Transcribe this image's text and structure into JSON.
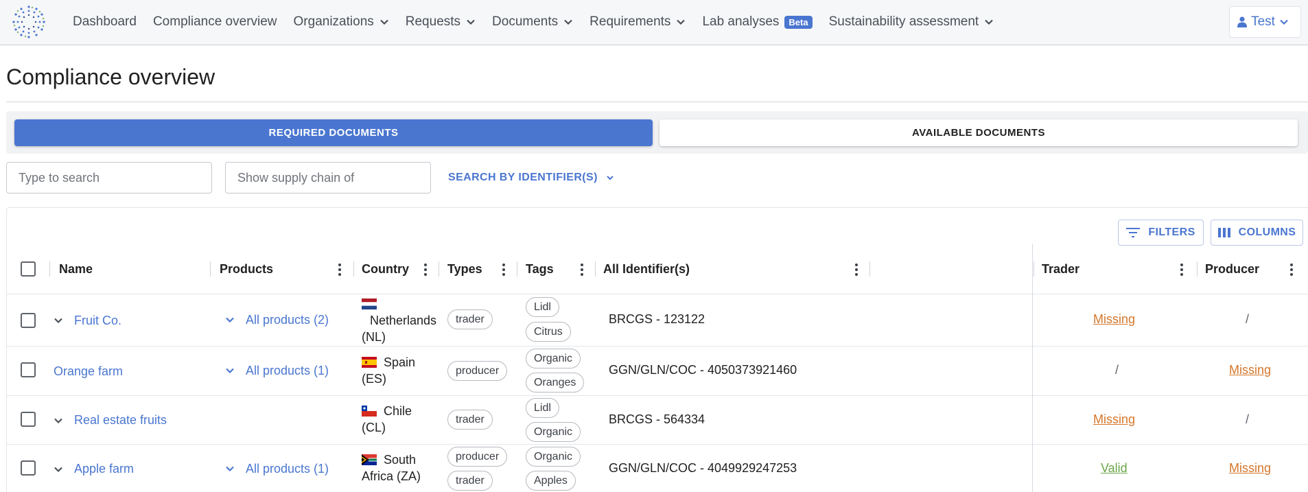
{
  "nav": {
    "items": [
      {
        "label": "Dashboard",
        "dropdown": false
      },
      {
        "label": "Compliance overview",
        "dropdown": false
      },
      {
        "label": "Organizations",
        "dropdown": true
      },
      {
        "label": "Requests",
        "dropdown": true
      },
      {
        "label": "Documents",
        "dropdown": true
      },
      {
        "label": "Requirements",
        "dropdown": true
      },
      {
        "label": "Lab analyses",
        "badge": "Beta",
        "dropdown": false
      },
      {
        "label": "Sustainability assessment",
        "dropdown": true
      }
    ],
    "user_label": "Test"
  },
  "page": {
    "title": "Compliance overview"
  },
  "doc_tabs": {
    "required": "REQUIRED DOCUMENTS",
    "available": "AVAILABLE DOCUMENTS",
    "active": "required"
  },
  "search": {
    "text_placeholder": "Type to search",
    "supply_chain_placeholder": "Show supply chain of",
    "identifier_button": "SEARCH BY IDENTIFIER(S)"
  },
  "toolbar": {
    "filters_label": "FILTERS",
    "columns_label": "COLUMNS"
  },
  "table": {
    "columns": {
      "name": "Name",
      "products": "Products",
      "country": "Country",
      "types": "Types",
      "tags": "Tags",
      "identifiers": "All Identifier(s)",
      "trader": "Trader",
      "producer": "Producer"
    },
    "rows": [
      {
        "name": "Fruit Co.",
        "expandable": true,
        "products": "All products (2)",
        "country_line1": "Netherlands",
        "country_line2": "(NL)",
        "types": [
          "trader"
        ],
        "tags": [
          "Lidl",
          "Citrus"
        ],
        "identifier": "BRCGS - 123122",
        "trader": "Missing",
        "producer": "/"
      },
      {
        "name": "Orange farm",
        "expandable": false,
        "products": "All products (1)",
        "country_line1": "Spain",
        "country_line2": "(ES)",
        "types": [
          "producer"
        ],
        "tags": [
          "Organic",
          "Oranges"
        ],
        "identifier": "GGN/GLN/COC - 4050373921460",
        "trader": "/",
        "producer": "Missing"
      },
      {
        "name": "Real estate fruits",
        "expandable": true,
        "products": "",
        "country_line1": "Chile",
        "country_line2": "(CL)",
        "types": [
          "trader"
        ],
        "tags": [
          "Lidl",
          "Organic"
        ],
        "identifier": "BRCGS - 564334",
        "trader": "Missing",
        "producer": "/"
      },
      {
        "name": "Apple farm",
        "expandable": true,
        "products": "All products (1)",
        "country_line1": "South",
        "country_line2": "Africa (ZA)",
        "types": [
          "producer",
          "trader"
        ],
        "tags": [
          "Organic",
          "Apples"
        ],
        "identifier": "GGN/GLN/COC - 4049929247253",
        "trader": "Valid",
        "producer": "Missing"
      }
    ]
  },
  "colors": {
    "accent": "#4a76d0",
    "missing": "#d4762a",
    "valid": "#6aa548"
  }
}
